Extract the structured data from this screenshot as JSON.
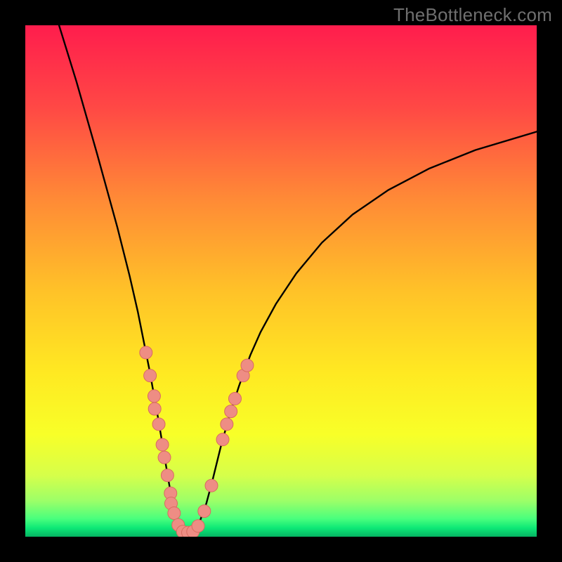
{
  "watermark": "TheBottleneck.com",
  "colors": {
    "background": "#000000",
    "gradient": [
      "#ff1d4d",
      "#ff6a3a",
      "#ffb42e",
      "#ffe324",
      "#faff24",
      "#caff6a",
      "#5cff80",
      "#07e36d",
      "#04b864"
    ],
    "curve": "#000000",
    "dotFill": "#ee8d84",
    "dotStroke": "#d86b60",
    "watermark": "#6f6f6f"
  },
  "chart_data": {
    "type": "line",
    "title": "",
    "xlabel": "",
    "ylabel": "",
    "xlim": [
      0,
      100
    ],
    "ylim": [
      0,
      100
    ],
    "grid": false,
    "legend": false,
    "curve": {
      "description": "V-shaped bottleneck curve with minimum at ~x=31, left branch steep, right branch shallow asymptote",
      "points": [
        {
          "x": 6.6,
          "y": 100.0
        },
        {
          "x": 10.0,
          "y": 89.0
        },
        {
          "x": 14.0,
          "y": 75.0
        },
        {
          "x": 18.0,
          "y": 60.5
        },
        {
          "x": 20.4,
          "y": 51.0
        },
        {
          "x": 22.0,
          "y": 44.0
        },
        {
          "x": 23.2,
          "y": 38.0
        },
        {
          "x": 24.2,
          "y": 33.0
        },
        {
          "x": 25.2,
          "y": 27.5
        },
        {
          "x": 26.0,
          "y": 23.0
        },
        {
          "x": 27.0,
          "y": 17.0
        },
        {
          "x": 28.0,
          "y": 11.0
        },
        {
          "x": 29.0,
          "y": 5.5
        },
        {
          "x": 30.0,
          "y": 2.2
        },
        {
          "x": 30.8,
          "y": 0.9
        },
        {
          "x": 31.6,
          "y": 0.7
        },
        {
          "x": 32.4,
          "y": 0.8
        },
        {
          "x": 33.2,
          "y": 1.4
        },
        {
          "x": 34.2,
          "y": 3.2
        },
        {
          "x": 35.4,
          "y": 6.5
        },
        {
          "x": 36.6,
          "y": 11.0
        },
        {
          "x": 38.2,
          "y": 17.5
        },
        {
          "x": 40.0,
          "y": 24.0
        },
        {
          "x": 41.8,
          "y": 29.5
        },
        {
          "x": 44.0,
          "y": 35.5
        },
        {
          "x": 46.0,
          "y": 40.0
        },
        {
          "x": 49.0,
          "y": 45.5
        },
        {
          "x": 53.0,
          "y": 51.5
        },
        {
          "x": 58.0,
          "y": 57.5
        },
        {
          "x": 64.0,
          "y": 63.0
        },
        {
          "x": 71.0,
          "y": 67.8
        },
        {
          "x": 79.0,
          "y": 72.0
        },
        {
          "x": 88.0,
          "y": 75.6
        },
        {
          "x": 100.0,
          "y": 79.2
        }
      ]
    },
    "scatter": {
      "description": "Observed data points (salmon dots) clustered along the lower portions of both branches near the valley",
      "points": [
        {
          "x": 23.6,
          "y": 36.0
        },
        {
          "x": 24.4,
          "y": 31.5
        },
        {
          "x": 25.2,
          "y": 27.5
        },
        {
          "x": 25.3,
          "y": 25.0
        },
        {
          "x": 26.1,
          "y": 22.0
        },
        {
          "x": 26.8,
          "y": 18.0
        },
        {
          "x": 27.2,
          "y": 15.5
        },
        {
          "x": 27.8,
          "y": 12.0
        },
        {
          "x": 28.4,
          "y": 8.5
        },
        {
          "x": 28.5,
          "y": 6.5
        },
        {
          "x": 29.1,
          "y": 4.6
        },
        {
          "x": 29.9,
          "y": 2.3
        },
        {
          "x": 30.8,
          "y": 1.0
        },
        {
          "x": 31.8,
          "y": 0.8
        },
        {
          "x": 32.8,
          "y": 1.0
        },
        {
          "x": 33.8,
          "y": 2.1
        },
        {
          "x": 35.0,
          "y": 5.0
        },
        {
          "x": 36.4,
          "y": 10.0
        },
        {
          "x": 38.6,
          "y": 19.0
        },
        {
          "x": 39.4,
          "y": 22.0
        },
        {
          "x": 40.2,
          "y": 24.5
        },
        {
          "x": 41.0,
          "y": 27.0
        },
        {
          "x": 42.6,
          "y": 31.5
        },
        {
          "x": 43.4,
          "y": 33.5
        }
      ]
    }
  }
}
